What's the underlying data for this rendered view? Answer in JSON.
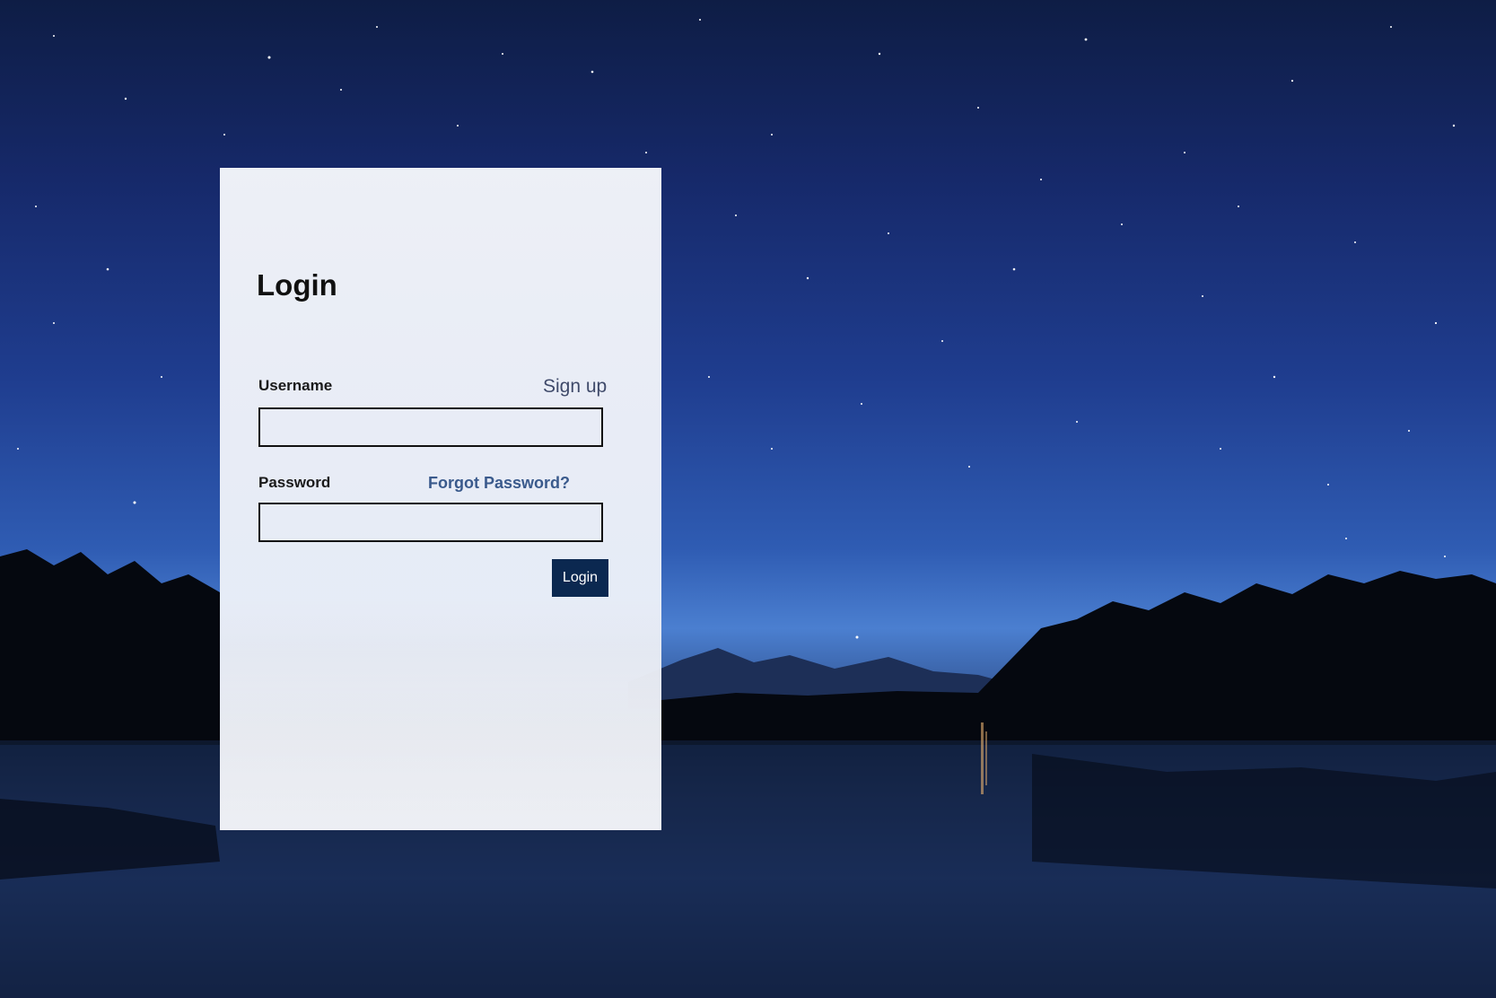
{
  "login_card": {
    "title": "Login",
    "username_label": "Username",
    "signup_link": "Sign up",
    "username_value": "",
    "password_label": "Password",
    "forgot_password_link": "Forgot Password?",
    "password_value": "",
    "login_button": "Login"
  },
  "colors": {
    "button_background": "#0b2850",
    "link_color": "#3a5a8c"
  }
}
